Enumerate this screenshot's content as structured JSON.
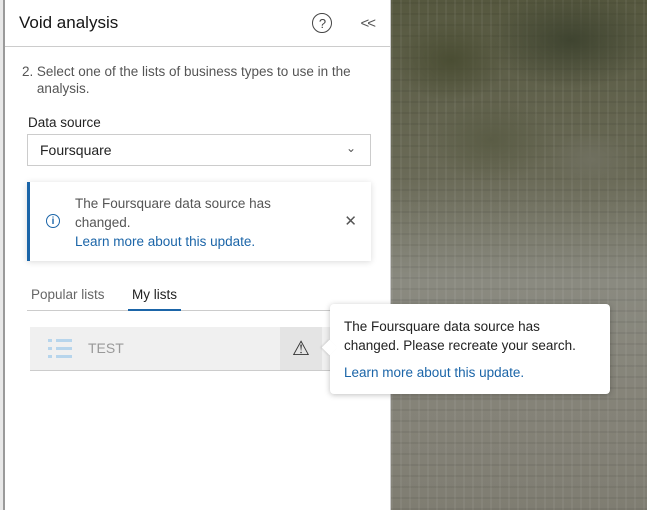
{
  "panel": {
    "title": "Void analysis",
    "help_icon": "?",
    "collapse_icon": "<<",
    "step_number": "2.",
    "step_text": "Select one of the lists of business types to use in the analysis.",
    "data_source_label": "Data source",
    "data_source_value": "Foursquare",
    "notice": {
      "message": "The Foursquare data source has changed.",
      "link": "Learn more about this update."
    },
    "tabs": [
      {
        "label": "Popular lists"
      },
      {
        "label": "My lists"
      }
    ],
    "list_item": {
      "name": "TEST",
      "warning_icon": "⚠"
    }
  },
  "popover": {
    "message": "The Foursquare data source has changed. Please recreate your search.",
    "link": "Learn more about this update."
  },
  "colors": {
    "accent": "#1b65a8"
  }
}
